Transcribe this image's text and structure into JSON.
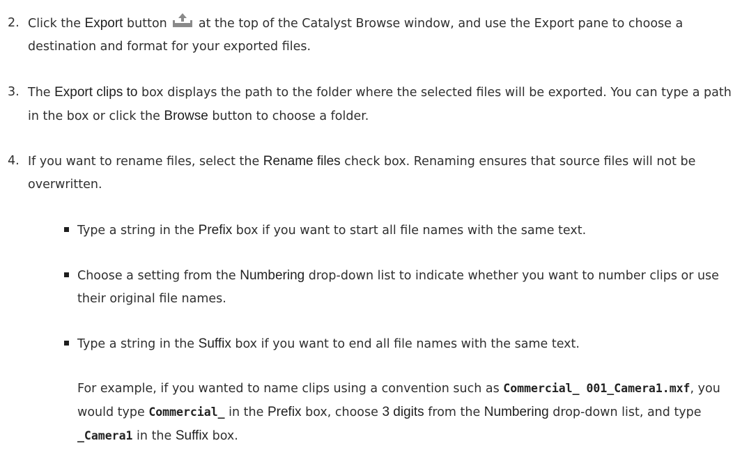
{
  "steps": [
    {
      "number": "2.",
      "segments": [
        {
          "t": "text",
          "v": "Click the "
        },
        {
          "t": "ui",
          "v": "Export"
        },
        {
          "t": "text",
          "v": " button "
        },
        {
          "t": "icon",
          "v": "export-icon"
        },
        {
          "t": "text",
          "v": " at the top of the Catalyst Browse window, and use the Export pane to choose a destination and format for your exported files."
        }
      ]
    },
    {
      "number": "3.",
      "segments": [
        {
          "t": "text",
          "v": "The "
        },
        {
          "t": "ui",
          "v": "Export clips to"
        },
        {
          "t": "text",
          "v": " box displays the path to the folder where the selected files will be exported. You can type a path in the box or click the "
        },
        {
          "t": "ui",
          "v": "Browse"
        },
        {
          "t": "text",
          "v": " button to choose a folder."
        }
      ]
    },
    {
      "number": "4.",
      "segments": [
        {
          "t": "text",
          "v": "If you want to rename files, select the "
        },
        {
          "t": "ui",
          "v": "Rename files"
        },
        {
          "t": "text",
          "v": " check box. Renaming ensures that source files will not be overwritten."
        }
      ]
    }
  ],
  "bullets": [
    {
      "segments": [
        {
          "t": "text",
          "v": "Type a string in the "
        },
        {
          "t": "ui",
          "v": "Prefix"
        },
        {
          "t": "text",
          "v": " box if you want to start all file names with the same text."
        }
      ]
    },
    {
      "segments": [
        {
          "t": "text",
          "v": "Choose a setting from the "
        },
        {
          "t": "ui",
          "v": "Numbering"
        },
        {
          "t": "text",
          "v": " drop-down list to indicate whether you want to number clips or use their original file names."
        }
      ]
    },
    {
      "segments": [
        {
          "t": "text",
          "v": "Type a string in the "
        },
        {
          "t": "ui",
          "v": "Suffix"
        },
        {
          "t": "text",
          "v": " box if you want to end all file names with the same text."
        }
      ]
    }
  ],
  "example": {
    "segments": [
      {
        "t": "text",
        "v": "For example, if you wanted to name clips using a convention such as "
      },
      {
        "t": "code",
        "v": "Commercial_ 001_Camera1.mxf"
      },
      {
        "t": "text",
        "v": ", you would type "
      },
      {
        "t": "code",
        "v": "Commercial_"
      },
      {
        "t": "text",
        "v": " in the "
      },
      {
        "t": "ui",
        "v": "Prefix"
      },
      {
        "t": "text",
        "v": " box, choose "
      },
      {
        "t": "ui",
        "v": "3 digits"
      },
      {
        "t": "text",
        "v": " from the "
      },
      {
        "t": "ui",
        "v": "Numbering"
      },
      {
        "t": "text",
        "v": " drop-down list, and type "
      },
      {
        "t": "code",
        "v": "_Camera1"
      },
      {
        "t": "text",
        "v": " in the "
      },
      {
        "t": "ui",
        "v": "Suffix"
      },
      {
        "t": "text",
        "v": " box."
      }
    ]
  },
  "colors": {
    "text": "#2f2f2f",
    "icon": "#8a8a8a",
    "bullet": "#1e1e1e"
  }
}
